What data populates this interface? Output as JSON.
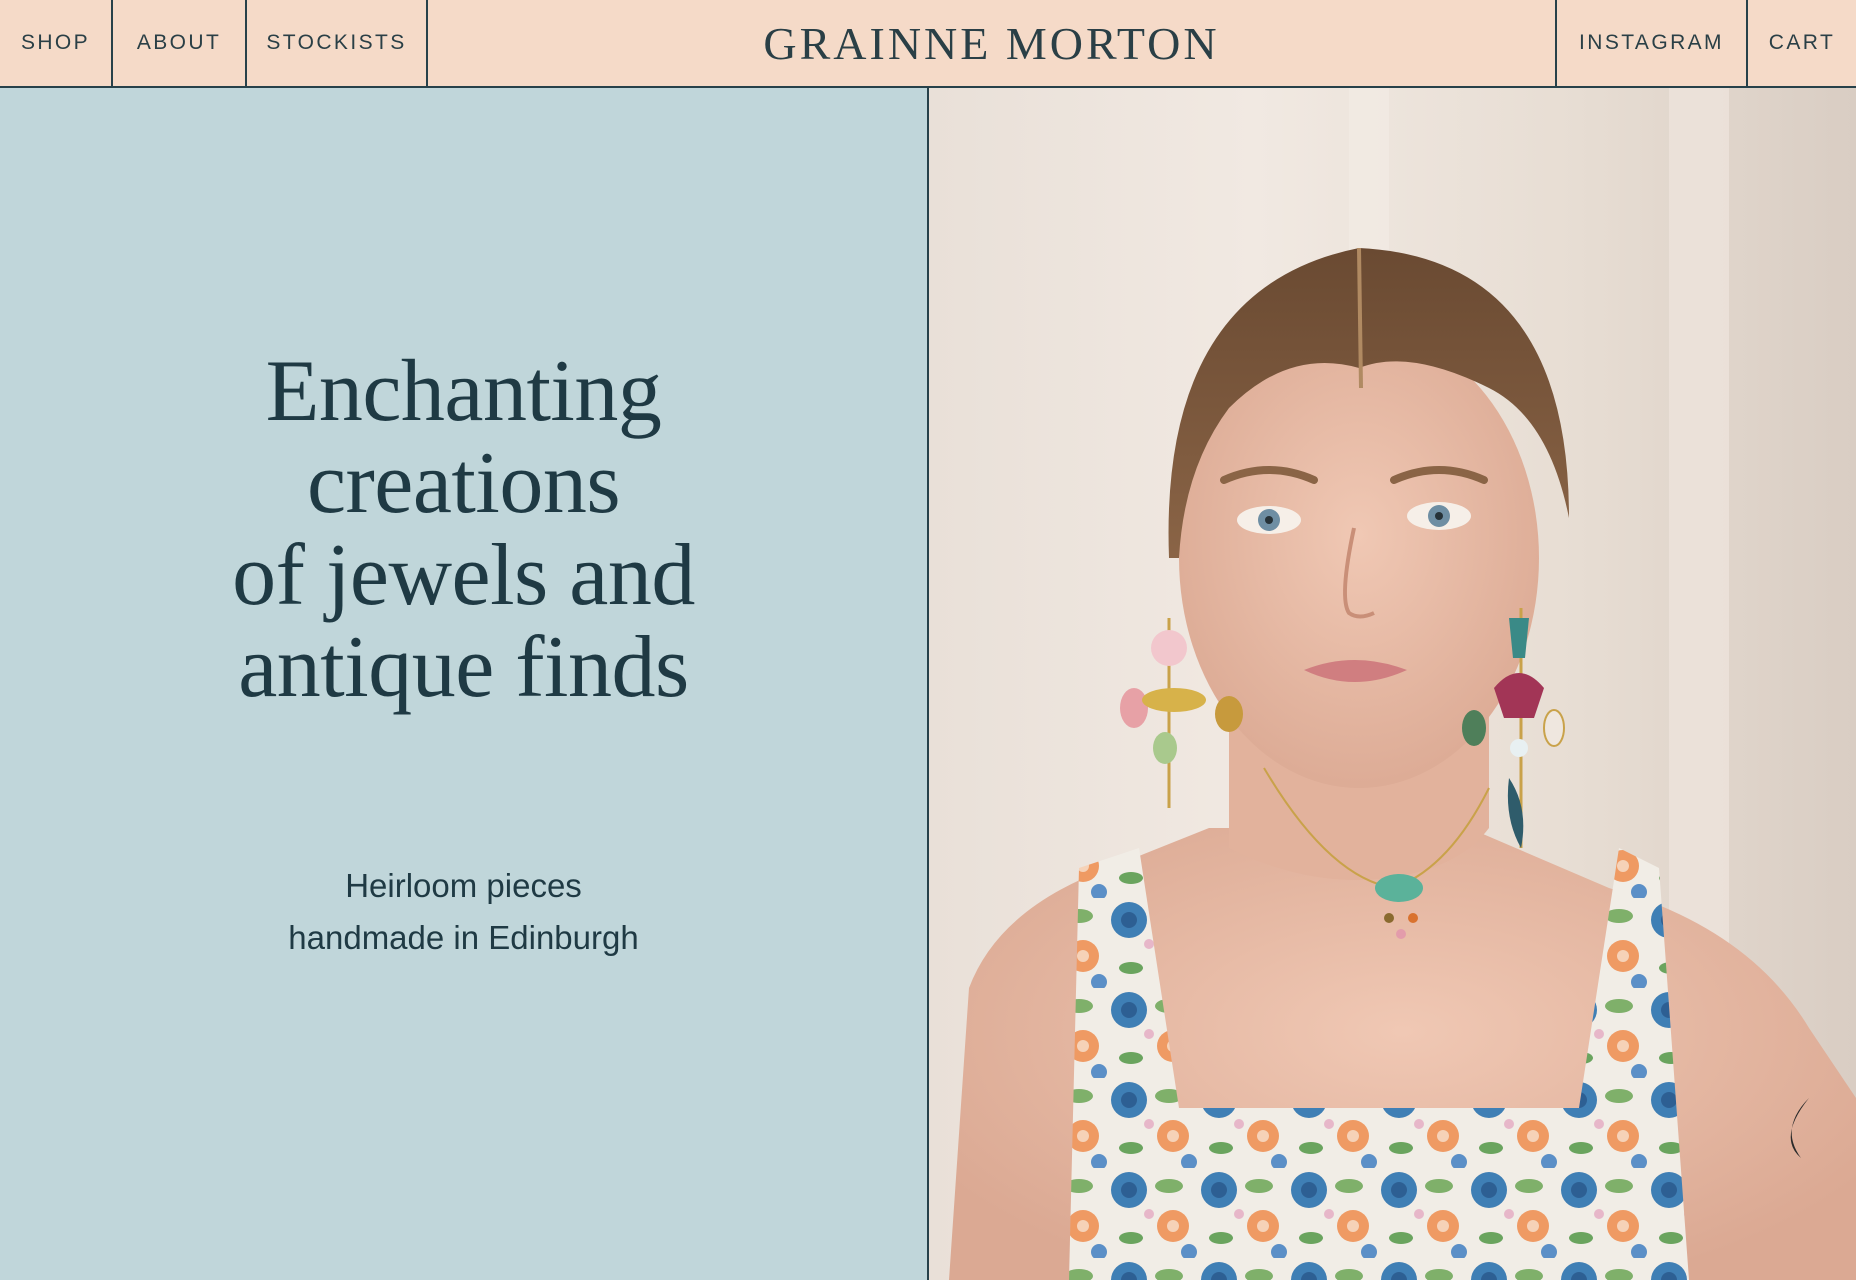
{
  "nav": {
    "left": [
      {
        "label": "SHOP"
      },
      {
        "label": "ABOUT"
      },
      {
        "label": "STOCKISTS"
      }
    ],
    "brand": "GRAINNE MORTON",
    "right": [
      {
        "label": "INSTAGRAM"
      },
      {
        "label": "CART"
      }
    ]
  },
  "hero": {
    "headline_lines": [
      "Enchanting",
      "creations",
      "of jewels and",
      "antique finds"
    ],
    "subline_lines": [
      "Heirloom pieces",
      "handmade in Edinburgh"
    ]
  },
  "colors": {
    "nav_bg": "#f5dac8",
    "hero_bg": "#c0d6da",
    "ink": "#1f3a44"
  }
}
